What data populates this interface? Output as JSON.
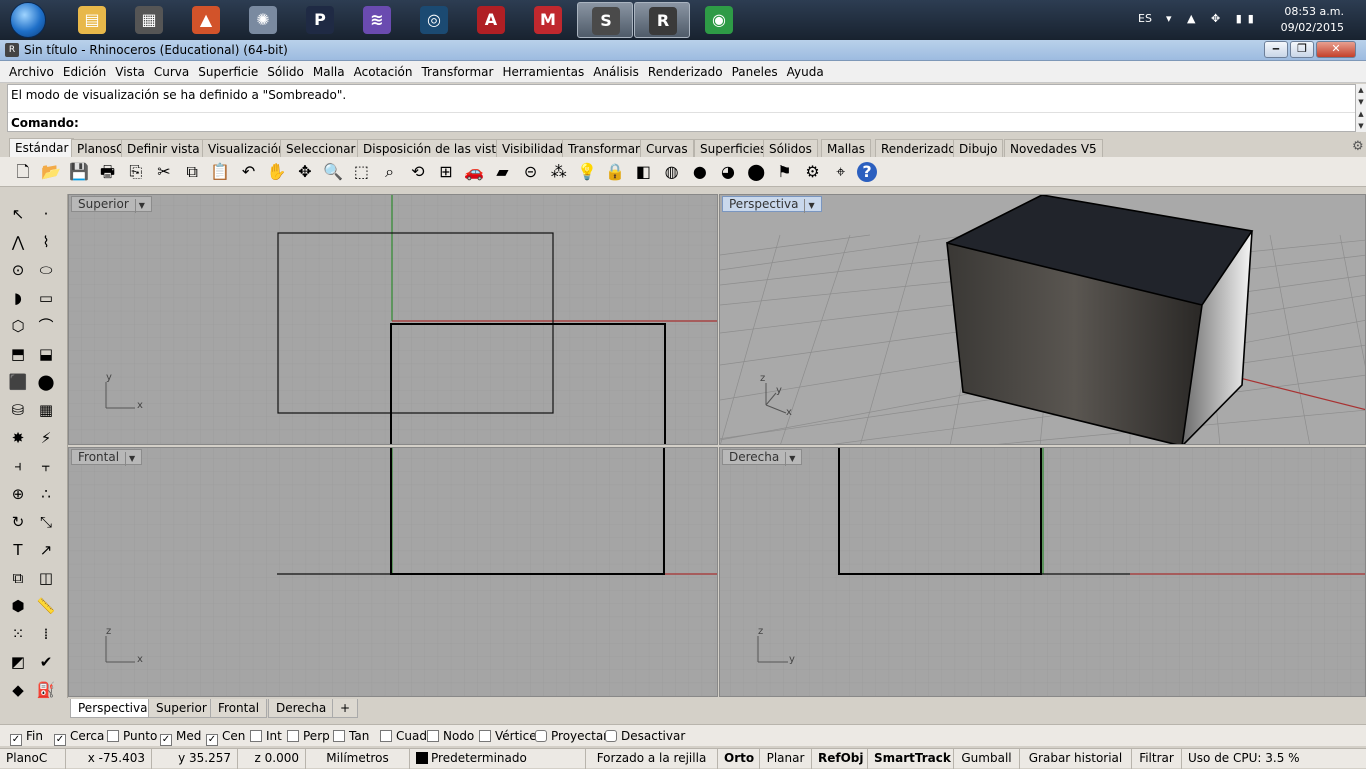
{
  "taskbar": {
    "apps": [
      {
        "name": "explorer-app",
        "glyph": "▤",
        "color": "#e8b84a",
        "active": false
      },
      {
        "name": "app-pro",
        "glyph": "▦",
        "color": "#555555",
        "active": false
      },
      {
        "name": "matlab-app",
        "glyph": "▲",
        "color": "#d2532a",
        "active": false
      },
      {
        "name": "atom-app",
        "glyph": "✺",
        "color": "#7a8aa0",
        "active": false
      },
      {
        "name": "app-p",
        "glyph": "P",
        "color": "#1f2a44",
        "active": false
      },
      {
        "name": "media-app",
        "glyph": "≋",
        "color": "#6a4bb0",
        "active": false
      },
      {
        "name": "steam-app",
        "glyph": "◎",
        "color": "#1b4a72",
        "active": false
      },
      {
        "name": "autocad-app",
        "glyph": "A",
        "color": "#b01f24",
        "active": false
      },
      {
        "name": "mplabide-app",
        "glyph": "M",
        "color": "#c0282e",
        "active": false
      },
      {
        "name": "sublime-app",
        "glyph": "S",
        "color": "#4a4a4a",
        "active": true
      },
      {
        "name": "rhino-app",
        "glyph": "R",
        "color": "#3a3a3a",
        "active": true
      },
      {
        "name": "chrome-app",
        "glyph": "◉",
        "color": "#2e9b46",
        "active": false
      }
    ],
    "language": "ES",
    "time": "08:53 a.m.",
    "date": "09/02/2015"
  },
  "window": {
    "title": "Sin título - Rhinoceros (Educational) (64-bit)"
  },
  "menu": [
    "Archivo",
    "Edición",
    "Vista",
    "Curva",
    "Superficie",
    "Sólido",
    "Malla",
    "Acotación",
    "Transformar",
    "Herramientas",
    "Análisis",
    "Renderizado",
    "Paneles",
    "Ayuda"
  ],
  "command": {
    "history": "El modo de visualización se ha definido a \"Sombreado\".",
    "prompt": "Comando:"
  },
  "toolbar_tabs": [
    "Estándar",
    "PlanosC",
    "Definir vista",
    "Visualización",
    "Seleccionar",
    "Disposición de las vistas",
    "Visibilidad",
    "Transformar",
    "Curvas",
    "Superficies",
    "Sólidos",
    "Mallas",
    "Renderizado",
    "Dibujo",
    "Novedades V5"
  ],
  "active_toolbar_tab": "Estándar",
  "toolbar_icons": [
    {
      "name": "new-file-icon",
      "glyph": "🗋"
    },
    {
      "name": "open-file-icon",
      "glyph": "📂"
    },
    {
      "name": "save-icon",
      "glyph": "💾"
    },
    {
      "name": "print-icon",
      "glyph": "🖶"
    },
    {
      "name": "import-icon",
      "glyph": "⎘"
    },
    {
      "name": "cut-icon",
      "glyph": "✂"
    },
    {
      "name": "copy-icon",
      "glyph": "⧉"
    },
    {
      "name": "paste-icon",
      "glyph": "📋"
    },
    {
      "name": "undo-icon",
      "glyph": "↶"
    },
    {
      "name": "pan-hand-icon",
      "glyph": "✋"
    },
    {
      "name": "move-view-icon",
      "glyph": "✥"
    },
    {
      "name": "zoom-icon",
      "glyph": "🔍"
    },
    {
      "name": "zoom-window-icon",
      "glyph": "⬚"
    },
    {
      "name": "zoom-selected-icon",
      "glyph": "⌕"
    },
    {
      "name": "rotate-view-icon",
      "glyph": "⟲"
    },
    {
      "name": "four-views-icon",
      "glyph": "⊞"
    },
    {
      "name": "car-icon",
      "glyph": "🚗"
    },
    {
      "name": "render-preview-icon",
      "glyph": "▰"
    },
    {
      "name": "snap-icon",
      "glyph": "⊝"
    },
    {
      "name": "select-points-icon",
      "glyph": "⁂"
    },
    {
      "name": "light-bulb-icon",
      "glyph": "💡"
    },
    {
      "name": "lock-icon",
      "glyph": "🔒"
    },
    {
      "name": "layers-icon",
      "glyph": "◧"
    },
    {
      "name": "color-wheel-icon",
      "glyph": "◍"
    },
    {
      "name": "shaded-sphere-icon",
      "glyph": "●"
    },
    {
      "name": "rendered-sphere-icon",
      "glyph": "◕"
    },
    {
      "name": "blue-sphere-icon",
      "glyph": "⬤"
    },
    {
      "name": "flag-icon",
      "glyph": "⚑"
    },
    {
      "name": "settings-icon",
      "glyph": "⚙"
    },
    {
      "name": "dimension-icon",
      "glyph": "⌖"
    },
    {
      "name": "help-icon",
      "glyph": "?"
    }
  ],
  "side_icons": [
    {
      "name": "select-arrow-icon",
      "glyph": "↖"
    },
    {
      "name": "point-icon",
      "glyph": "·"
    },
    {
      "name": "polyline-icon",
      "glyph": "⋀"
    },
    {
      "name": "curve-icon",
      "glyph": "⌇"
    },
    {
      "name": "circle-icon",
      "glyph": "⊙"
    },
    {
      "name": "ellipse-icon",
      "glyph": "⬭"
    },
    {
      "name": "arc-icon",
      "glyph": "◗"
    },
    {
      "name": "rectangle-icon",
      "glyph": "▭"
    },
    {
      "name": "polygon-icon",
      "glyph": "⬡"
    },
    {
      "name": "fillet-curve-icon",
      "glyph": "⌒"
    },
    {
      "name": "surface-points-icon",
      "glyph": "⬒"
    },
    {
      "name": "extrude-curve-icon",
      "glyph": "⬓"
    },
    {
      "name": "box-icon",
      "glyph": "⬛"
    },
    {
      "name": "sphere-icon",
      "glyph": "⬤"
    },
    {
      "name": "cylinder-icon",
      "glyph": "⛁"
    },
    {
      "name": "mesh-surface-icon",
      "glyph": "▦"
    },
    {
      "name": "explode-icon",
      "glyph": "✸"
    },
    {
      "name": "trim-icon",
      "glyph": "⚡"
    },
    {
      "name": "split-icon",
      "glyph": "⫞"
    },
    {
      "name": "join-icon",
      "glyph": "⫟"
    },
    {
      "name": "boolean-union-icon",
      "glyph": "⊕"
    },
    {
      "name": "array-icon",
      "glyph": "∴"
    },
    {
      "name": "rotate-icon",
      "glyph": "↻"
    },
    {
      "name": "scale-icon",
      "glyph": "⤡"
    },
    {
      "name": "text-icon",
      "glyph": "T"
    },
    {
      "name": "dimension-side-icon",
      "glyph": "↗"
    },
    {
      "name": "group-icon",
      "glyph": "⧉"
    },
    {
      "name": "mirror-icon",
      "glyph": "◫"
    },
    {
      "name": "solid-tools-icon",
      "glyph": "⬢"
    },
    {
      "name": "ruler-icon",
      "glyph": "📏"
    },
    {
      "name": "grid-array-icon",
      "glyph": "⁙"
    },
    {
      "name": "distance-icon",
      "glyph": "⁞"
    },
    {
      "name": "analyze-icon",
      "glyph": "◩"
    },
    {
      "name": "check-icon",
      "glyph": "✔"
    },
    {
      "name": "render-object-icon",
      "glyph": "◆"
    },
    {
      "name": "paint-bucket-icon",
      "glyph": "⛽"
    }
  ],
  "viewports": {
    "top": {
      "label": "Superior",
      "axes": [
        "x",
        "y"
      ]
    },
    "perspective": {
      "label": "Perspectiva",
      "axes": [
        "x",
        "y",
        "z"
      ]
    },
    "front": {
      "label": "Frontal",
      "axes": [
        "x",
        "z"
      ]
    },
    "right": {
      "label": "Derecha",
      "axes": [
        "y",
        "z"
      ]
    }
  },
  "viewport_tabs": [
    "Perspectiva",
    "Superior",
    "Frontal",
    "Derecha"
  ],
  "active_viewport_tab": "Perspectiva",
  "osnaps": [
    {
      "label": "Fin",
      "checked": true
    },
    {
      "label": "Cerca",
      "checked": true
    },
    {
      "label": "Punto",
      "checked": false
    },
    {
      "label": "Med",
      "checked": true
    },
    {
      "label": "Cen",
      "checked": true
    },
    {
      "label": "Int",
      "checked": false
    },
    {
      "label": "Perp",
      "checked": false
    },
    {
      "label": "Tan",
      "checked": false
    },
    {
      "label": "Cuad",
      "checked": false
    },
    {
      "label": "Nodo",
      "checked": false
    },
    {
      "label": "Vértice",
      "checked": false
    },
    {
      "label": "Proyectar",
      "checked": false
    },
    {
      "label": "Desactivar",
      "checked": false
    }
  ],
  "status": {
    "cplane": "PlanoC",
    "x": "x -75.403",
    "y": "y 35.257",
    "z": "z 0.000",
    "units": "Milímetros",
    "layer": "Predeterminado",
    "grid_snap": "Forzado a la rejilla",
    "ortho": "Orto",
    "planar": "Planar",
    "osnap": "RefObj",
    "smarttrack": "SmartTrack",
    "gumball": "Gumball",
    "record_history": "Grabar historial",
    "filter": "Filtrar",
    "cpu": "Uso de CPU: 3.5 %"
  }
}
